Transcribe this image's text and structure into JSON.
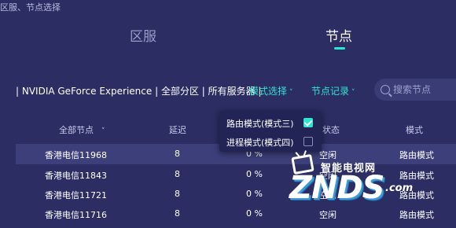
{
  "window": {
    "title": "区服、节点选择"
  },
  "tabs": [
    {
      "label": "区服"
    },
    {
      "label": "节点"
    }
  ],
  "filter": {
    "path": "| NVIDIA GeForce Experience | 全部分区 | 所有服务器 |",
    "mode_select": "模式选择",
    "node_record": "节点记录",
    "caret": "˅"
  },
  "search": {
    "placeholder": "搜索节点"
  },
  "table": {
    "headers": {
      "node": "全部节点",
      "node_sort": "˅",
      "latency": "延迟",
      "status": "状态",
      "mode": "模式"
    },
    "rows": [
      {
        "name": "香港电信11968",
        "latency": "8",
        "load": "0 %",
        "status": "空闲",
        "mode": "路由模式"
      },
      {
        "name": "香港电信11843",
        "latency": "8",
        "load": "0 %",
        "status": "空闲",
        "mode": "路由模式"
      },
      {
        "name": "香港电信11721",
        "latency": "8",
        "load": "0 %",
        "status": "空闲",
        "mode": "路由模式"
      },
      {
        "name": "香港电信11716",
        "latency": "8",
        "load": "0 %",
        "status": "空闲",
        "mode": "路由模式"
      }
    ]
  },
  "mode_popup": {
    "items": [
      {
        "label": "路由模式(模式三)",
        "checked": true
      },
      {
        "label": "进程模式(模式四)",
        "checked": false
      }
    ]
  },
  "watermark": {
    "cn": "智能电视网",
    "big": "ZNDS",
    "com": ".com"
  },
  "colors": {
    "background": "#2b2d63",
    "accent": "#2ee6d0",
    "selected_row": "#3c3f7a"
  }
}
